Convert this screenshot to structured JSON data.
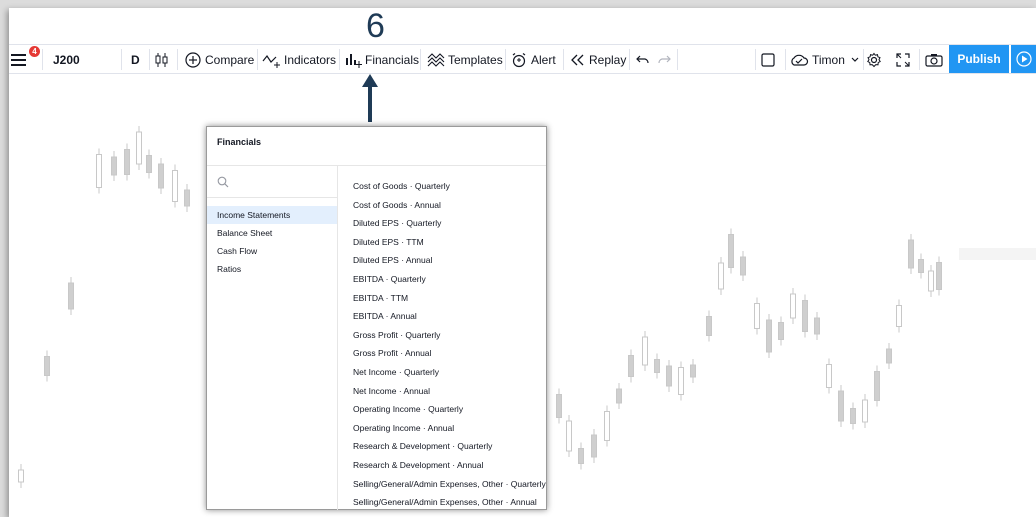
{
  "step_number": "6",
  "toolbar": {
    "menu_badge": "4",
    "symbol": "J200",
    "interval": "D",
    "compare_label": "Compare",
    "indicators_label": "Indicators",
    "financials_label": "Financials",
    "templates_label": "Templates",
    "alert_label": "Alert",
    "replay_label": "Replay",
    "user_label": "Timon",
    "publish_label": "Publish"
  },
  "popup": {
    "title": "Financials",
    "search_placeholder": "",
    "categories": [
      "Income Statements",
      "Balance Sheet",
      "Cash Flow",
      "Ratios"
    ],
    "active_category": "Income Statements",
    "items": [
      "Cost of Goods · Quarterly",
      "Cost of Goods · Annual",
      "Diluted EPS · Quarterly",
      "Diluted EPS · TTM",
      "Diluted EPS · Annual",
      "EBITDA · Quarterly",
      "EBITDA · TTM",
      "EBITDA · Annual",
      "Gross Profit · Quarterly",
      "Gross Profit · Annual",
      "Net Income · Quarterly",
      "Net Income · Annual",
      "Operating Income · Quarterly",
      "Operating Income · Annual",
      "Research & Development · Quarterly",
      "Research & Development · Annual",
      "Selling/General/Admin Expenses, Other · Quarterly",
      "Selling/General/Admin Expenses, Other · Annual"
    ]
  },
  "colors": {
    "accent": "#2196f3",
    "badge": "#e53935",
    "active_category_bg": "#e3effd",
    "step_number": "#1f3b56"
  }
}
